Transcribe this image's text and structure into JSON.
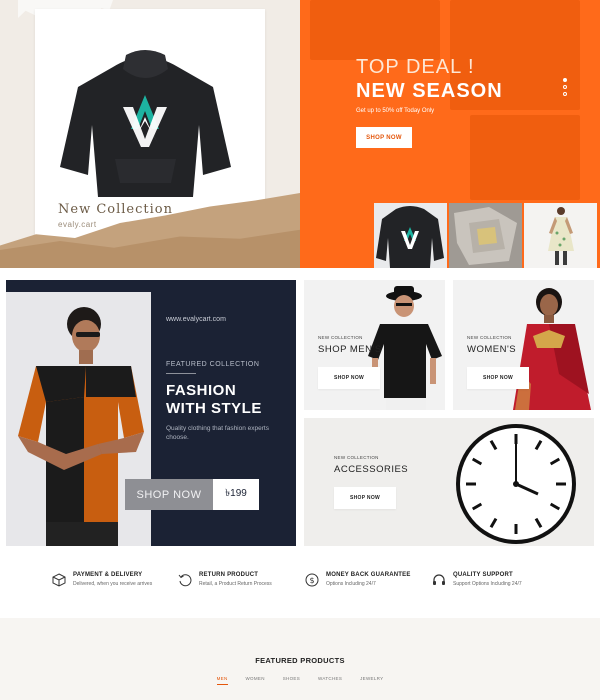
{
  "hero_left": {
    "title": "New Collection",
    "subtitle": "evaly.cart"
  },
  "hero_right": {
    "kicker": "TOP DEAL !",
    "title": "NEW SEASON",
    "subtitle": "Get up to 50% off Today Only",
    "button": "SHOP NOW",
    "slider_dots": 3,
    "active_dot": 0
  },
  "featured": {
    "url": "www.evalycart.com",
    "kicker": "FEATURED COLLECTION",
    "title_line1": "FASHION",
    "title_line2": "WITH STYLE",
    "description": "Quality clothing that fashion experts choose.",
    "button": "SHOP NOW",
    "price": "৳199"
  },
  "cards": {
    "men": {
      "kicker": "NEW COLLECTION",
      "title": "SHOP MEN'S",
      "button": "SHOP NOW"
    },
    "women": {
      "kicker": "NEW COLLECTION",
      "title": "WOMEN'S",
      "button": "SHOP NOW"
    },
    "accessories": {
      "kicker": "NEW COLLECTION",
      "title": "ACCESSORIES",
      "button": "SHOP NOW"
    }
  },
  "services": [
    {
      "icon": "box-icon",
      "title": "PAYMENT & DELIVERY",
      "desc": "Delivered, when you receive arrives"
    },
    {
      "icon": "return-icon",
      "title": "RETURN PRODUCT",
      "desc": "Retail, a Product Return Process"
    },
    {
      "icon": "money-icon",
      "title": "MONEY BACK GUARANTEE",
      "desc": "Options Including 24/7"
    },
    {
      "icon": "headset-icon",
      "title": "QUALITY SUPPORT",
      "desc": "Support Options Including 24/7"
    }
  ],
  "products": {
    "title": "FEATURED PRODUCTS",
    "tabs": [
      "MEN",
      "WOMEN",
      "SHOES",
      "WATCHES",
      "JEWELRY"
    ],
    "active_tab": "MEN"
  },
  "colors": {
    "brand_orange": "#ff6a1a",
    "navy": "#1b2234"
  }
}
